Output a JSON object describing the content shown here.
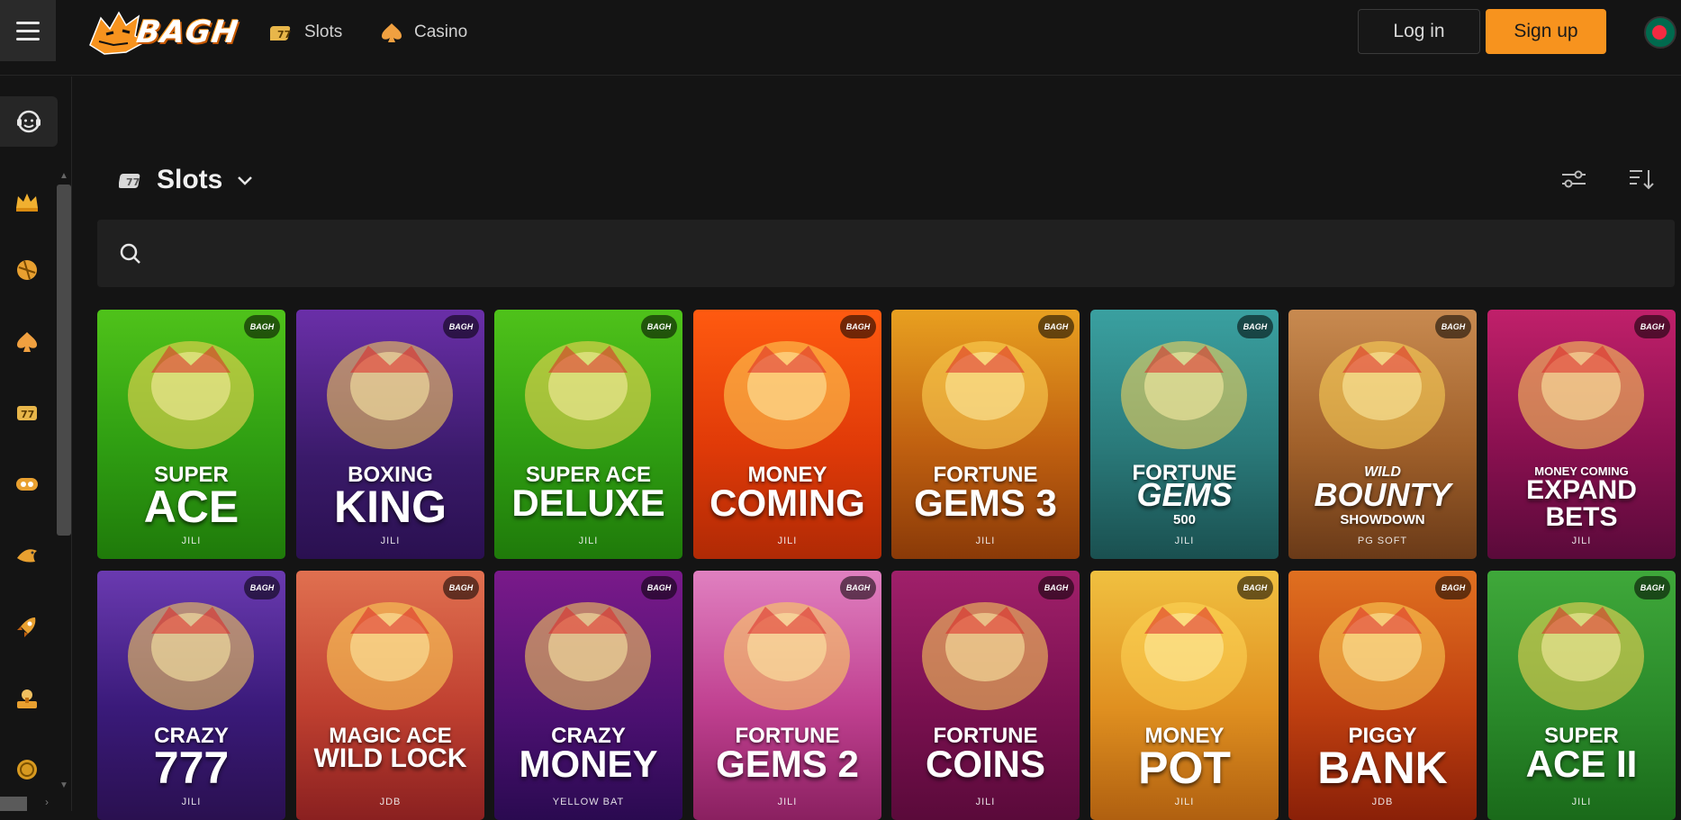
{
  "header": {
    "logo_text": "BAGH",
    "nav": [
      {
        "label": "Slots",
        "icon": "slots-icon"
      },
      {
        "label": "Casino",
        "icon": "casino-icon"
      }
    ],
    "login_label": "Log in",
    "signup_label": "Sign up",
    "flag": "bangladesh-flag-icon"
  },
  "sidebar": {
    "items": [
      {
        "icon": "crown-icon"
      },
      {
        "icon": "sports-ball-icon"
      },
      {
        "icon": "casino-chip-icon"
      },
      {
        "icon": "slots-777-icon"
      },
      {
        "icon": "bingo-icon"
      },
      {
        "icon": "fishing-icon"
      },
      {
        "icon": "rocket-icon"
      },
      {
        "icon": "lottery-icon"
      },
      {
        "icon": "coin-icon"
      }
    ]
  },
  "section": {
    "title": "Slots"
  },
  "search": {
    "placeholder": ""
  },
  "colors": {
    "accent": "#f7931e",
    "background": "#141414"
  },
  "games": [
    {
      "title_top": "SUPER",
      "title_main": "ACE",
      "provider": "JILI",
      "bg": "green"
    },
    {
      "title_top": "BOXING",
      "title_main": "KING",
      "provider": "JILI",
      "bg": "purple"
    },
    {
      "title_top": "SUPER ACE",
      "title_main": "DELUXE",
      "provider": "JILI",
      "bg": "green"
    },
    {
      "title_top": "MONEY",
      "title_main": "COMING",
      "provider": "JILI",
      "bg": "orange"
    },
    {
      "title_top": "FORTUNE",
      "title_main": "GEMS 3",
      "provider": "JILI",
      "bg": "amber"
    },
    {
      "title_top": "FORTUNE",
      "title_main": "GEMS",
      "subtitle": "500",
      "provider": "JILI",
      "bg": "teal"
    },
    {
      "title_top": "WILD",
      "title_main": "BOUNTY",
      "subtitle": "SHOWDOWN",
      "provider": "PG SOFT",
      "bg": "tan"
    },
    {
      "title_top": "MONEY COMING",
      "title_main": "EXPAND BETS",
      "provider": "JILI",
      "bg": "magenta"
    },
    {
      "title_top": "CRAZY",
      "title_main": "777",
      "provider": "JILI",
      "bg": "violet"
    },
    {
      "title_top": "MAGIC ACE",
      "title_main": "WILD LOCK",
      "provider": "JDB",
      "bg": "pinkred"
    },
    {
      "title_top": "CRAZY",
      "title_main": "MONEY",
      "provider": "YELLOW BAT",
      "bg": "purple2"
    },
    {
      "title_top": "FORTUNE",
      "title_main": "GEMS 2",
      "provider": "JILI",
      "bg": "pink"
    },
    {
      "title_top": "FORTUNE",
      "title_main": "COINS",
      "provider": "JILI",
      "bg": "crimson"
    },
    {
      "title_top": "MONEY",
      "title_main": "POT",
      "provider": "JILI",
      "bg": "gold"
    },
    {
      "title_top": "PIGGY",
      "title_main": "BANK",
      "provider": "JDB",
      "bg": "redorange"
    },
    {
      "title_top": "SUPER",
      "title_main": "ACE II",
      "provider": "JILI",
      "bg": "green2"
    }
  ],
  "card_badge": "BAGH"
}
